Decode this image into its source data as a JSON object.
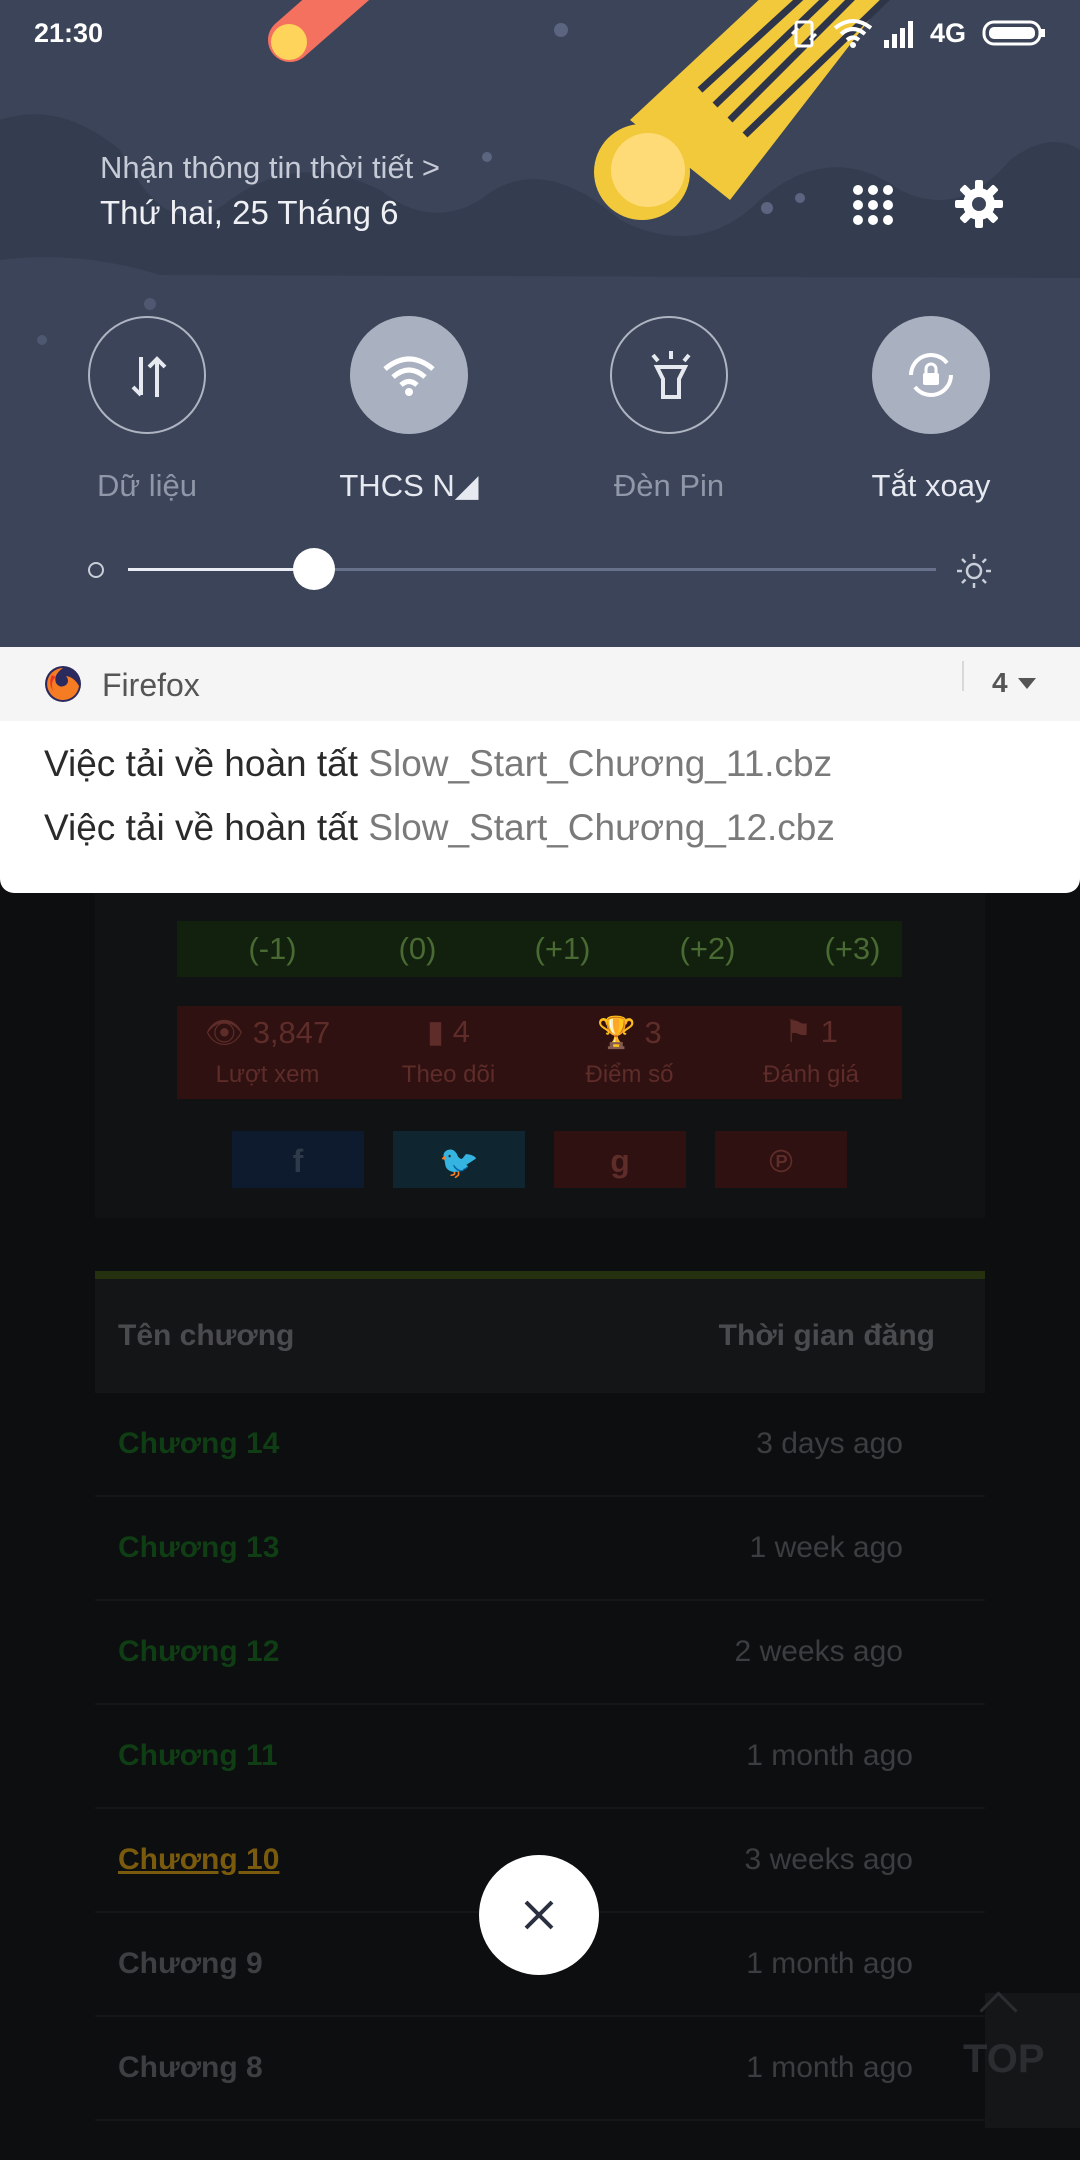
{
  "status_bar": {
    "time": "21:30",
    "network": "4G"
  },
  "header": {
    "weather_link": "Nhận thông tin thời tiết >",
    "date": "Thứ hai, 25 Tháng 6"
  },
  "tiles": [
    {
      "label": "Dữ liệu",
      "icon": "data-transfer-icon",
      "active": false
    },
    {
      "label": "THCS N◢",
      "icon": "wifi-icon",
      "active": true
    },
    {
      "label": "Đèn Pin",
      "icon": "flashlight-icon",
      "active": false
    },
    {
      "label": "Tắt xoay",
      "icon": "rotation-lock-icon",
      "active": true
    }
  ],
  "brightness": {
    "level": 0.23
  },
  "notification": {
    "app": "Firefox",
    "count": "4",
    "items": [
      {
        "title": "Việc tải về hoàn tất",
        "file": "Slow_Start_Chương_11.cbz"
      },
      {
        "title": "Việc tải về hoàn tất",
        "file": "Slow_Start_Chương_12.cbz"
      }
    ]
  },
  "page": {
    "votes": [
      "(-1)",
      "(0)",
      "(+1)",
      "(+2)",
      "(+3)"
    ],
    "stats": [
      {
        "value": "3,847",
        "label": "Lượt xem",
        "icon": "eye-icon"
      },
      {
        "value": "4",
        "label": "Theo dõi",
        "icon": "bookmark-icon"
      },
      {
        "value": "3",
        "label": "Điểm số",
        "icon": "trophy-icon"
      },
      {
        "value": "1",
        "label": "Đánh giá",
        "icon": "flag-icon"
      }
    ],
    "share": [
      {
        "glyph": "f",
        "icon": "facebook-icon"
      },
      {
        "glyph": "🐦",
        "icon": "twitter-icon"
      },
      {
        "glyph": "g",
        "icon": "google-plus-icon"
      },
      {
        "glyph": "℗",
        "icon": "pinterest-icon"
      }
    ],
    "table": {
      "headers": [
        "Tên chương",
        "Thời gian đăng"
      ],
      "rows": [
        {
          "chapter": "Chương 14",
          "time": "3 days ago"
        },
        {
          "chapter": "Chương 13",
          "time": "1 week ago"
        },
        {
          "chapter": "Chương 12",
          "time": "2 weeks ago"
        },
        {
          "chapter": "Chương 11",
          "time": "1 month ago"
        },
        {
          "chapter": "Chương 10",
          "time": "3 weeks ago"
        },
        {
          "chapter": "Chương 9",
          "time": "1 month ago"
        },
        {
          "chapter": "Chương 8",
          "time": "1 month ago"
        }
      ]
    },
    "top_button": "TOP"
  },
  "colors": {
    "shade_bg": "#3b4458",
    "chapter_new": "#0f3d14",
    "chapter_visited": "#7a5a0c",
    "chapter_normal": "#3e3f42"
  }
}
